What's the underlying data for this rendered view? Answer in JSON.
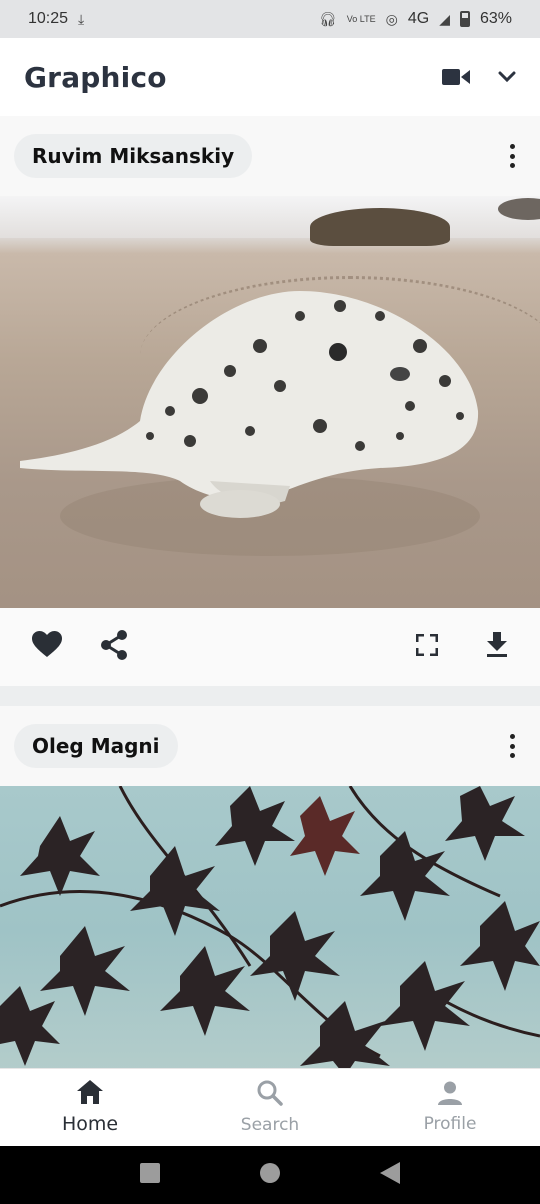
{
  "status_bar": {
    "time": "10:25",
    "download_icon": "download-done-icon",
    "network_label": "4G",
    "volte_label": "Vo LTE",
    "battery": "63%"
  },
  "app_bar": {
    "title": "Graphico",
    "video_icon": "video-camera-icon",
    "menu_icon": "chevron-down-icon"
  },
  "posts": [
    {
      "author": "Ruvim Miksanskiy",
      "image_subject": "seal-on-beach",
      "actions": [
        "like",
        "share",
        "fullscreen",
        "download"
      ]
    },
    {
      "author": "Oleg Magni",
      "image_subject": "maple-leaves-against-sky"
    }
  ],
  "bottom_nav": {
    "items": [
      {
        "label": "Home",
        "icon": "home-icon",
        "active": true
      },
      {
        "label": "Search",
        "icon": "search-icon",
        "active": false
      },
      {
        "label": "Profile",
        "icon": "person-icon",
        "active": false
      }
    ]
  },
  "colors": {
    "title": "#2c3340",
    "chip_bg": "#eceeef",
    "active_nav": "#2a2f36",
    "inactive_nav": "#9aa0a6"
  }
}
